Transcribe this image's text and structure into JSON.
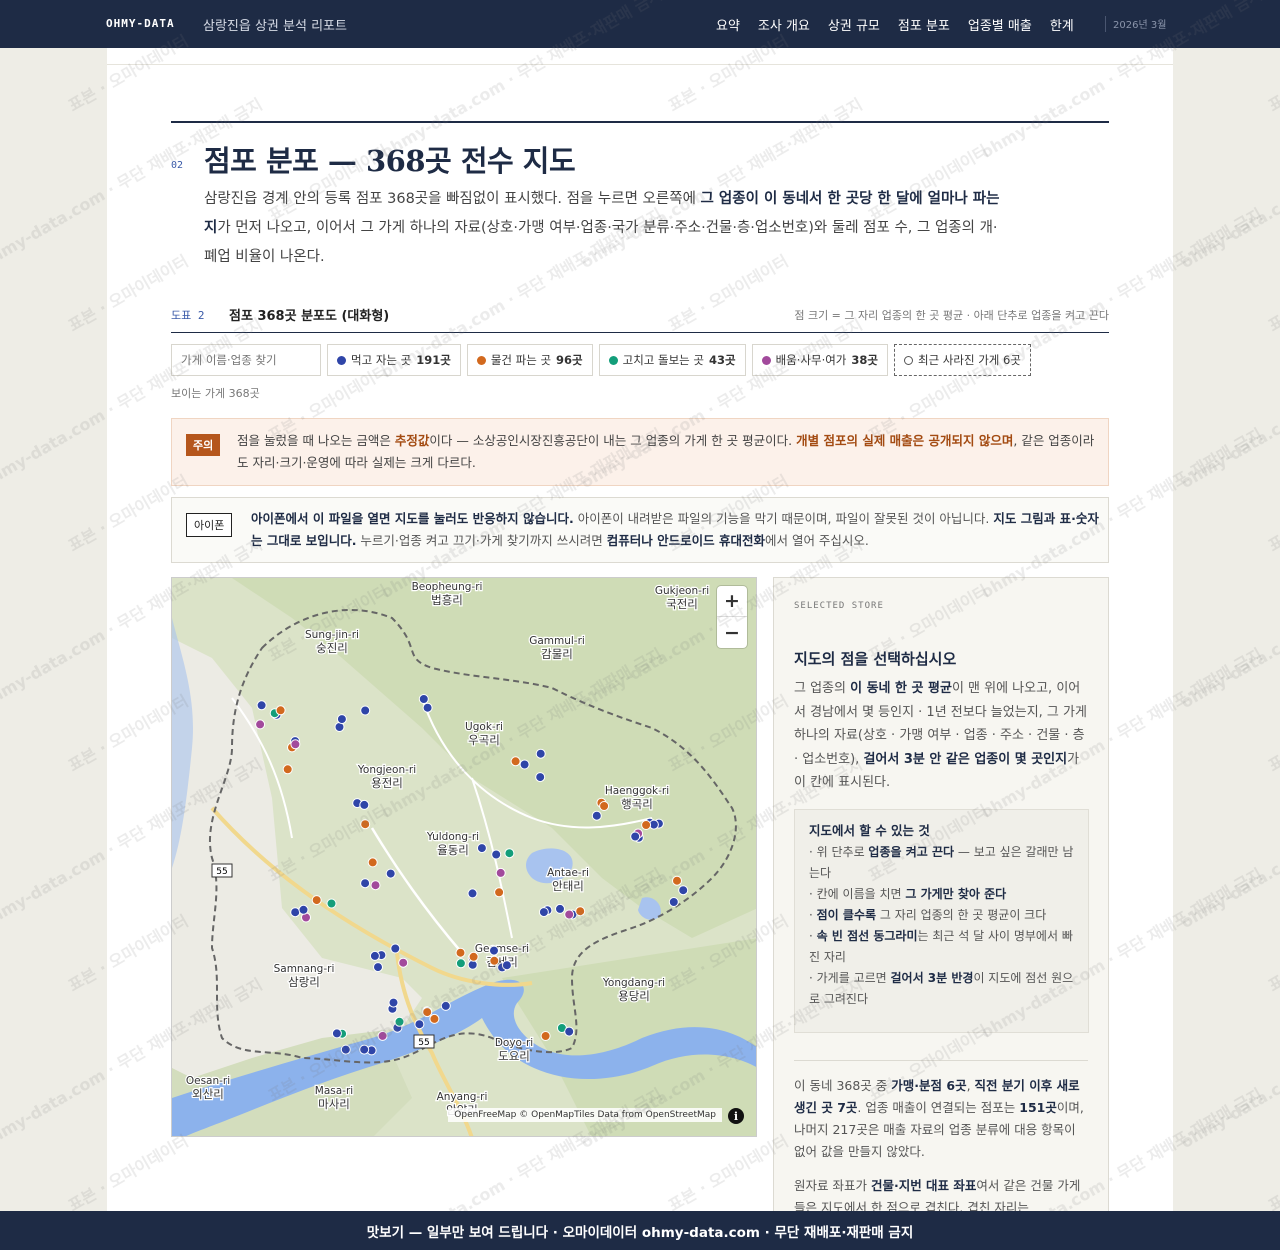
{
  "nav": {
    "brand": "OHMY-DATA",
    "report_name": "삼랑진읍 상권 분석 리포트",
    "links": [
      "요약",
      "조사 개요",
      "상권 규모",
      "점포 분포",
      "업종별 매출",
      "한계"
    ],
    "date": "2026년 3월"
  },
  "section": {
    "number": "02",
    "title": "점포 분포 — 368곳 전수 지도",
    "intro_1": "삼랑진읍 경계 안의 등록 점포 368곳을 빠짐없이 표시했다. 점을 누르면 오른쪽에 ",
    "intro_bold": "그 업종이 이 동네서 한 곳당 한 달에 얼마나 파는지",
    "intro_2": "가 먼저 나오고, 이어서 그 가게 하나의 자료(상호·가맹 여부·업종·국가 분류·주소·건물·층·업소번호)와 둘레 점포 수, 그 업종의 개·폐업 비율이 나온다."
  },
  "figure": {
    "number": "도표 2",
    "title": "점포 368곳 분포도 (대화형)",
    "note": "점 크기 = 그 자리 업종의 한 곳 평균 · 아래 단추로 업종을 켜고 끈다"
  },
  "filters": {
    "search_placeholder": "가게 이름·업종 찾기",
    "chips": [
      {
        "label": "먹고 자는 곳",
        "count": "191곳",
        "color": "#2f45a8"
      },
      {
        "label": "물건 파는 곳",
        "count": "96곳",
        "color": "#d2691e"
      },
      {
        "label": "고치고 돌보는 곳",
        "count": "43곳",
        "color": "#139e7a"
      },
      {
        "label": "배움·사무·여가",
        "count": "38곳",
        "color": "#a24a9c"
      }
    ],
    "closed_chip": "최근 사라진 가게 6곳",
    "visible_count": "보이는 가게 368곳"
  },
  "warning": {
    "tag": "주의",
    "text_1": "점을 눌렀을 때 나오는 금액은 ",
    "hl_1": "추정값",
    "text_2": "이다 — 소상공인시장진흥공단이 내는 그 업종의 가게 한 곳 평균이다. ",
    "hl_2": "개별 점포의 실제 매출은 공개되지 않으며",
    "text_3": ", 같은 업종이라도 자리·크기·운영에 따라 실제는 크게 다르다."
  },
  "ios": {
    "tag": "아이폰",
    "b1": "아이폰에서 이 파일을 열면 지도를 눌러도 반응하지 않습니다.",
    "t1": " 아이폰이 내려받은 파일의 기능을 막기 때문이며, 파일이 잘못된 것이 아닙니다. ",
    "b2": "지도 그림과 표·숫자는 그대로 보입니다.",
    "t2": " 누르기·업종 켜고 끄기·가게 찾기까지 쓰시려면 ",
    "b3": "컴퓨터나 안드로이드 휴대전화",
    "t3": "에서 열어 주십시오."
  },
  "map": {
    "zoom_in": "+",
    "zoom_out": "−",
    "attribution": "OpenFreeMap © OpenMapTiles Data from OpenStreetMap",
    "info": "i",
    "road_55a": "55",
    "road_55b": "55",
    "places": [
      {
        "en": "Beopheung-ri",
        "ko": "법흥리"
      },
      {
        "en": "Gukjeon-ri",
        "ko": "국전리"
      },
      {
        "en": "Sung-jin-ri",
        "ko": "숭진리"
      },
      {
        "en": "Gammul-ri",
        "ko": "감물리"
      },
      {
        "en": "Ugok-ri",
        "ko": "우곡리"
      },
      {
        "en": "Yongjeon-ri",
        "ko": "용전리"
      },
      {
        "en": "Haenggok-ri",
        "ko": "행곡리"
      },
      {
        "en": "Yuldong-ri",
        "ko": "율동리"
      },
      {
        "en": "Antae-ri",
        "ko": "안태리"
      },
      {
        "en": "Geomse-ri",
        "ko": "검세리"
      },
      {
        "en": "Samnang-ri",
        "ko": "삼랑리"
      },
      {
        "en": "Yongdang-ri",
        "ko": "용당리"
      },
      {
        "en": "Doyo-ri",
        "ko": "도요리"
      },
      {
        "en": "Oesan-ri",
        "ko": "외산리"
      },
      {
        "en": "Masa-ri",
        "ko": "마사리"
      },
      {
        "en": "Anyang-ri",
        "ko": "안양리"
      }
    ]
  },
  "panel": {
    "kicker": "SELECTED STORE",
    "title": "지도의 점을 선택하십시오",
    "desc_1": "그 업종의 ",
    "desc_b1": "이 동네 한 곳 평균",
    "desc_2": "이 맨 위에 나오고, 이어서 경남에서 몇 등인지 · 1년 전보다 늘었는지, 그 가게 하나의 자료(상호 · 가맹 여부 · 업종 · 주소 · 건물 · 층 · 업소번호), ",
    "desc_b2": "걸어서 3분 안 같은 업종이 몇 곳인지",
    "desc_3": "가 이 칸에 표시된다.",
    "howto_title": "지도에서 할 수 있는 것",
    "howto": [
      {
        "pre": "· 위 단추로 ",
        "b": "업종을 켜고 끈다",
        "post": " — 보고 싶은 갈래만 남는다"
      },
      {
        "pre": "· 칸에 이름을 치면 ",
        "b": "그 가게만 찾아 준다",
        "post": ""
      },
      {
        "pre": "· ",
        "b": "점이 클수록",
        "post": " 그 자리 업종의 한 곳 평균이 크다"
      },
      {
        "pre": "· ",
        "b": "속 빈 점선 동그라미",
        "post": "는 최근 석 달 사이 명부에서 빠진 자리"
      },
      {
        "pre": "· 가게를 고르면 ",
        "b": "걸어서 3분 반경",
        "post": "이 지도에 점선 원으로 그려진다"
      }
    ],
    "stat_1": "이 동네 368곳 중 ",
    "stat_b1": "가맹·분점 6곳",
    "stat_2": ", ",
    "stat_b2": "직전 분기 이후 새로 생긴 곳 7곳",
    "stat_3": ". 업종 매출이 연결되는 점포는 ",
    "stat_b3": "151곳",
    "stat_4": "이며, 나머지 217곳은 매출 자료의 업종 분류에 대응 항목이 없어 값을 만들지 않았다.",
    "coord_1": "원자료 좌표가 ",
    "coord_b1": "건물·지번 대표 좌표",
    "coord_2": "여서 같은 건물 가게들은 지도에서 한 점으로 겹친다. 겹친 자리는"
  },
  "watermark": {
    "a": "표본 · 오마이데이터",
    "b": "ohmy-data.com · 무단 재배포·재판매 금지"
  },
  "footer": "맛보기 — 일부만 보여 드립니다 · 오마이데이터 ohmy-data.com · 무단 재배포·재판매 금지"
}
